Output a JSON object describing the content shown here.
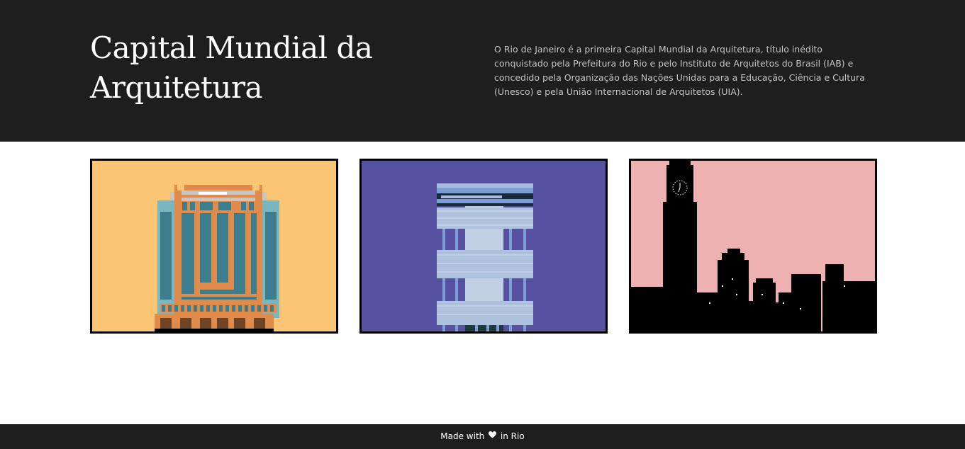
{
  "header": {
    "title": "Capital Mundial da Arquitetura",
    "intro": "O Rio de Janeiro é a primeira Capital Mundial da Arquitetura, título inédito conquistado pela Prefeitura do Rio e pelo Instituto de Arquitetos do Brasil (IAB) e concedido pela Organização das Nações Unidas para a Educação, Ciência e Cultura (Unesco) e pela União Internacional de Arquitetos (UIA)."
  },
  "gallery": {
    "cards": [
      {
        "illustration": "pixel-art-building-orange-blue",
        "background": "#fbc573"
      },
      {
        "illustration": "pixel-art-building-stacked-blocks",
        "background": "#5751a2"
      },
      {
        "illustration": "city-skyline-clock-tower-silhouette",
        "background": "#eeb1b1"
      }
    ]
  },
  "footer": {
    "prefix": "Made with",
    "suffix": "in Rio",
    "icon": "heart-icon"
  },
  "colors": {
    "header_bg": "#1e1e1e",
    "footer_bg": "#1e1e1e",
    "card_border": "#000000"
  }
}
